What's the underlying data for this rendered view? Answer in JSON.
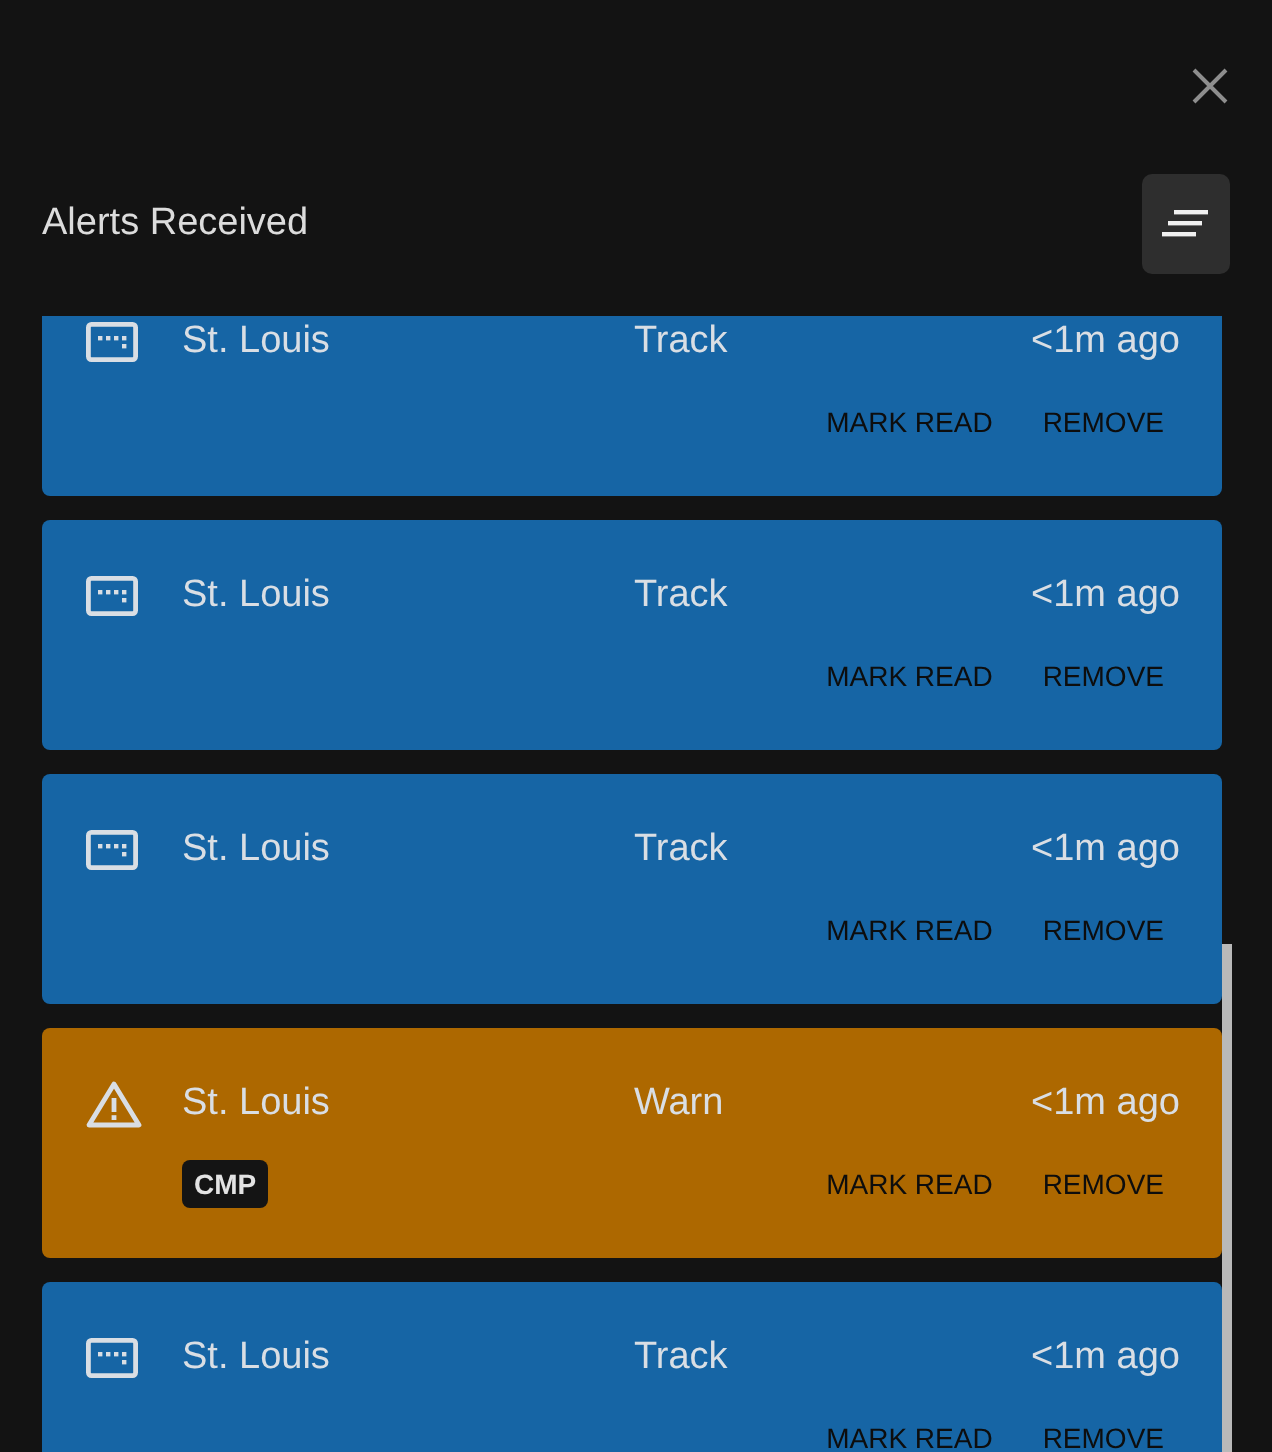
{
  "header": {
    "title": "Alerts Received"
  },
  "alerts": [
    {
      "kind": "track",
      "location": "St. Louis",
      "type": "Track",
      "time": "<1m ago",
      "actions": [
        "MARK READ",
        "REMOVE"
      ]
    },
    {
      "kind": "track",
      "location": "St. Louis",
      "type": "Track",
      "time": "<1m ago",
      "actions": [
        "MARK READ",
        "REMOVE"
      ]
    },
    {
      "kind": "track",
      "location": "St. Louis",
      "type": "Track",
      "time": "<1m ago",
      "actions": [
        "MARK READ",
        "REMOVE"
      ]
    },
    {
      "kind": "warn",
      "location": "St. Louis",
      "type": "Warn",
      "time": "<1m ago",
      "badge": "CMP",
      "actions": [
        "MARK READ",
        "REMOVE"
      ]
    },
    {
      "kind": "track",
      "location": "St. Louis",
      "type": "Track",
      "time": "<1m ago",
      "actions": [
        "MARK READ",
        "REMOVE"
      ]
    }
  ]
}
